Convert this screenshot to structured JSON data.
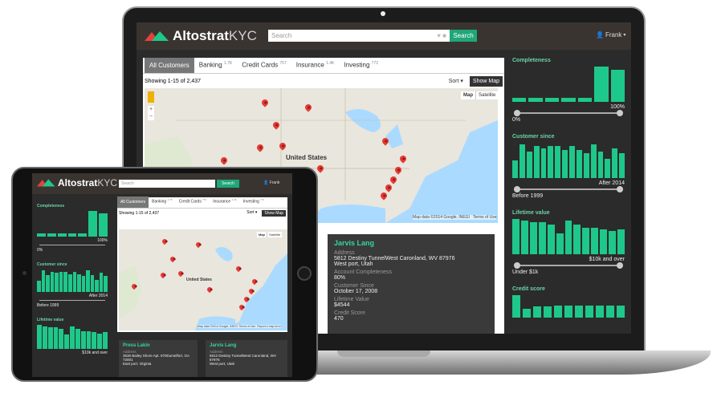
{
  "app": {
    "brand_bold": "Altostrat",
    "brand_light": "KYC"
  },
  "search": {
    "placeholder": "Search",
    "button": "Search"
  },
  "user": {
    "name": "Frank"
  },
  "tabs": [
    {
      "label": "All Customers",
      "count": ""
    },
    {
      "label": "Banking",
      "count": "1.7K"
    },
    {
      "label": "Credit Cards",
      "count": "757"
    },
    {
      "label": "Insurance",
      "count": "1.4K"
    },
    {
      "label": "Investing",
      "count": "772"
    }
  ],
  "list": {
    "showing": "Showing 1-15 of 2,437",
    "sort": "Sort",
    "show_map": "Show Map"
  },
  "map": {
    "type_map": "Map",
    "type_satellite": "Satellite",
    "label": "United States",
    "attribution": "Map data ©2014 Google, INEGI",
    "terms": "Terms of Use",
    "report": "Report a map error"
  },
  "sidebar": {
    "completeness": {
      "title": "Completeness",
      "bars": [
        0.12,
        0.12,
        0.12,
        0.12,
        0.12,
        1.0,
        0.9
      ],
      "hi": "100%",
      "lo": "0%"
    },
    "since": {
      "title": "Customer since",
      "bars": [
        0.5,
        0.95,
        0.75,
        0.9,
        0.85,
        0.9,
        0.9,
        0.8,
        0.9,
        0.8,
        0.7,
        0.95,
        0.75,
        0.55,
        0.85,
        0.7
      ],
      "hi": "After 2014",
      "lo": "Before 1999"
    },
    "lifetime": {
      "title": "Lifetime value",
      "bars": [
        1.0,
        0.95,
        0.9,
        0.9,
        0.85,
        0.6,
        0.95,
        0.85,
        0.75,
        0.75,
        0.7,
        0.65,
        0.7
      ],
      "hi": "$10k and over",
      "lo": "Under $1k"
    },
    "credit": {
      "title": "Credit score",
      "bars": [
        1.0,
        0.4,
        0.5,
        0.5,
        0.55,
        0.55,
        0.55,
        0.55,
        0.55,
        0.55,
        0.55
      ]
    }
  },
  "card_laptop": {
    "name": "Jarvis Lang",
    "address_label": "Address",
    "address": "5812 Destiny TunnelWest Caronland, WV 87976",
    "address2": "West port, Utah",
    "completeness_label": "Account Completeness",
    "completeness": "80%",
    "since_label": "Customer Since",
    "since": "October 17, 2008",
    "lifetime_label": "Lifetime Value",
    "lifetime": "$4544",
    "credit_label": "Credit Score",
    "credit": "470"
  },
  "tablet_cards": [
    {
      "name": "Press Lakin",
      "address_label": "Address",
      "address": "3536 Bailey Shore Apt. 970Dumelfort, GA 72001",
      "address2": "East port, Virginia"
    },
    {
      "name": "Jarvis Lang",
      "address_label": "Address",
      "address": "5812 Destiny TunnelWest Caronland, WV 87976",
      "address2": "West port, Utah"
    }
  ],
  "colors": {
    "accent": "#1ec88a",
    "topbar": "#3a3431",
    "panel": "#2b2b2b"
  }
}
